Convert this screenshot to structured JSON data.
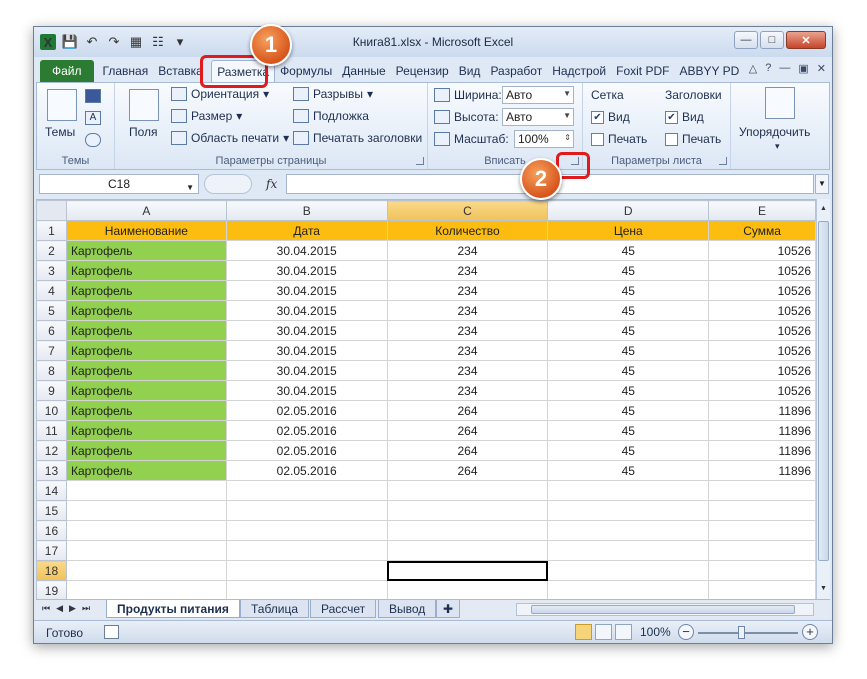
{
  "window": {
    "title": "Книга81.xlsx - Microsoft Excel"
  },
  "ribbon_tabs": [
    "Главная",
    "Вставка",
    "Разметка",
    "Формулы",
    "Данные",
    "Рецензир",
    "Вид",
    "Разработ",
    "Надстрой",
    "Foxit PDF",
    "ABBYY PD"
  ],
  "file_tab": "Файл",
  "groups": {
    "themes": {
      "label": "Темы",
      "button": "Темы"
    },
    "page_setup": {
      "label": "Параметры страницы",
      "fields": "Поля",
      "orientation": "Ориентация",
      "size": "Размер",
      "print_area": "Область печати",
      "breaks": "Разрывы",
      "background": "Подложка",
      "print_titles": "Печатать заголовки"
    },
    "fit": {
      "label": "Вписать",
      "width_label": "Ширина:",
      "width_value": "Авто",
      "height_label": "Высота:",
      "height_value": "Авто",
      "scale_label": "Масштаб:",
      "scale_value": "100%"
    },
    "sheet_options": {
      "label": "Параметры листа",
      "gridlines": "Сетка",
      "headings": "Заголовки",
      "view": "Вид",
      "print": "Печать"
    },
    "arrange": {
      "label": "Упорядочить"
    }
  },
  "formula_bar": {
    "name_box": "C18",
    "fx": "fx",
    "formula": ""
  },
  "columns": [
    "A",
    "B",
    "C",
    "D",
    "E"
  ],
  "table_header": [
    "Наименование",
    "Дата",
    "Количество",
    "Цена",
    "Сумма"
  ],
  "rows": [
    [
      "Картофель",
      "30.04.2015",
      "234",
      "45",
      "10526"
    ],
    [
      "Картофель",
      "30.04.2015",
      "234",
      "45",
      "10526"
    ],
    [
      "Картофель",
      "30.04.2015",
      "234",
      "45",
      "10526"
    ],
    [
      "Картофель",
      "30.04.2015",
      "234",
      "45",
      "10526"
    ],
    [
      "Картофель",
      "30.04.2015",
      "234",
      "45",
      "10526"
    ],
    [
      "Картофель",
      "30.04.2015",
      "234",
      "45",
      "10526"
    ],
    [
      "Картофель",
      "30.04.2015",
      "234",
      "45",
      "10526"
    ],
    [
      "Картофель",
      "30.04.2015",
      "234",
      "45",
      "10526"
    ],
    [
      "Картофель",
      "02.05.2016",
      "264",
      "45",
      "11896"
    ],
    [
      "Картофель",
      "02.05.2016",
      "264",
      "45",
      "11896"
    ],
    [
      "Картофель",
      "02.05.2016",
      "264",
      "45",
      "11896"
    ],
    [
      "Картофель",
      "02.05.2016",
      "264",
      "45",
      "11896"
    ]
  ],
  "row_numbers": [
    "1",
    "2",
    "3",
    "4",
    "5",
    "6",
    "7",
    "8",
    "9",
    "10",
    "11",
    "12",
    "13",
    "14",
    "15",
    "16",
    "17",
    "18",
    "19"
  ],
  "sheets": [
    "Продукты питания",
    "Таблица",
    "Рассчет",
    "Вывод"
  ],
  "status": {
    "ready": "Готово",
    "zoom": "100%"
  },
  "callouts": {
    "one": "1",
    "two": "2"
  },
  "colors": {
    "header_fill": "#fdbd10",
    "name_fill": "#92d050",
    "callout": "#e11b1b",
    "file_tab": "#2b7c32"
  }
}
